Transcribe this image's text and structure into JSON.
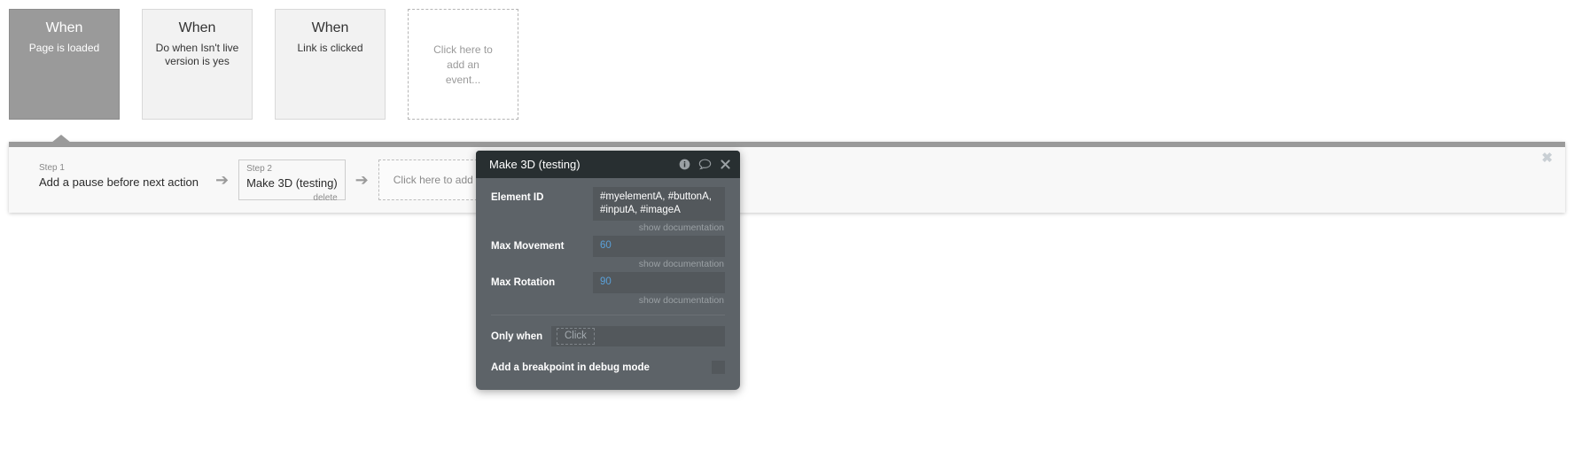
{
  "events": [
    {
      "when_label": "When",
      "description": "Page is loaded",
      "selected": true
    },
    {
      "when_label": "When",
      "description": "Do when Isn't live version is yes",
      "selected": false
    },
    {
      "when_label": "When",
      "description": "Link is clicked",
      "selected": false
    }
  ],
  "add_event": {
    "text": "Click here to add an event..."
  },
  "workflow": {
    "close_icon": "✖",
    "steps": [
      {
        "num": "Step 1",
        "title": "Add a pause before next action",
        "boxed": false,
        "delete_label": ""
      },
      {
        "num": "Step 2",
        "title": "Make 3D (testing)",
        "boxed": true,
        "delete_label": "delete"
      }
    ],
    "arrow": "➔",
    "add_action": {
      "text": "Click here to add an action..."
    }
  },
  "dialog": {
    "title": "Make 3D (testing)",
    "icons": {
      "info": "info-icon",
      "comment": "comment-icon",
      "close": "close-icon"
    },
    "fields": [
      {
        "label": "Element ID",
        "value": "#myelementA, #buttonA, #inputA, #imageA",
        "is_number": false,
        "doc_link": "show documentation"
      },
      {
        "label": "Max Movement",
        "value": "60",
        "is_number": true,
        "doc_link": "show documentation"
      },
      {
        "label": "Max Rotation",
        "value": "90",
        "is_number": true,
        "doc_link": "show documentation"
      }
    ],
    "only_when": {
      "label": "Only when",
      "placeholder": "Click"
    },
    "breakpoint": {
      "label": "Add a breakpoint in debug mode",
      "checked": false
    }
  },
  "colors": {
    "selected_card": "#9a9a9a",
    "dialog_body": "#5d6368",
    "dialog_header": "#282f31",
    "number_value": "#5aa0d8"
  }
}
